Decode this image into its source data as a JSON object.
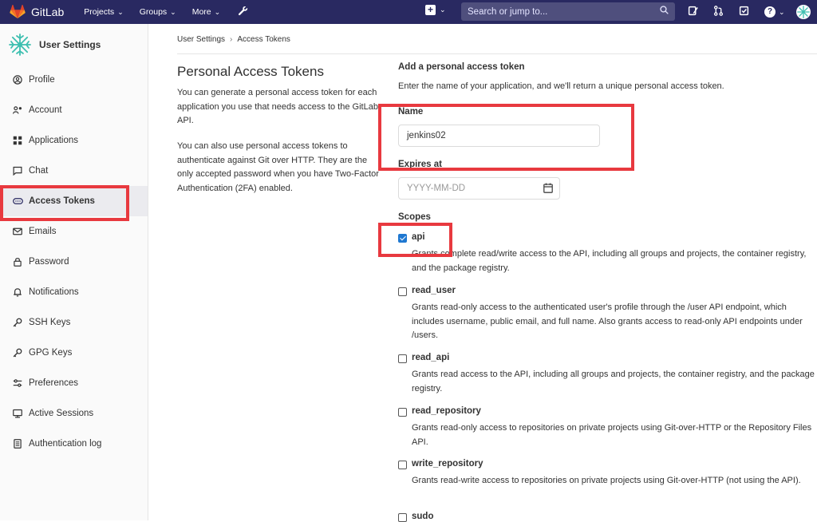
{
  "topbar": {
    "brand": "GitLab",
    "nav": [
      {
        "label": "Projects"
      },
      {
        "label": "Groups"
      },
      {
        "label": "More"
      }
    ],
    "search_placeholder": "Search or jump to..."
  },
  "sidebar": {
    "title": "User Settings",
    "items": [
      {
        "label": "Profile",
        "icon": "profile-icon",
        "active": false
      },
      {
        "label": "Account",
        "icon": "account-icon",
        "active": false
      },
      {
        "label": "Applications",
        "icon": "applications-icon",
        "active": false
      },
      {
        "label": "Chat",
        "icon": "chat-icon",
        "active": false
      },
      {
        "label": "Access Tokens",
        "icon": "token-icon",
        "active": true
      },
      {
        "label": "Emails",
        "icon": "mail-icon",
        "active": false
      },
      {
        "label": "Password",
        "icon": "lock-icon",
        "active": false
      },
      {
        "label": "Notifications",
        "icon": "bell-icon",
        "active": false
      },
      {
        "label": "SSH Keys",
        "icon": "key-icon",
        "active": false
      },
      {
        "label": "GPG Keys",
        "icon": "key-icon",
        "active": false
      },
      {
        "label": "Preferences",
        "icon": "preferences-icon",
        "active": false
      },
      {
        "label": "Active Sessions",
        "icon": "monitor-icon",
        "active": false
      },
      {
        "label": "Authentication log",
        "icon": "log-icon",
        "active": false
      }
    ]
  },
  "breadcrumb": {
    "parent": "User Settings",
    "current": "Access Tokens"
  },
  "intro": {
    "title": "Personal Access Tokens",
    "p1": "You can generate a personal access token for each application you use that needs access to the GitLab API.",
    "p2": "You can also use personal access tokens to authenticate against Git over HTTP. They are the only accepted password when you have Two-Factor Authentication (2FA) enabled."
  },
  "form": {
    "title": "Add a personal access token",
    "description": "Enter the name of your application, and we'll return a unique personal access token.",
    "name_label": "Name",
    "name_value": "jenkins02",
    "expires_label": "Expires at",
    "expires_placeholder": "YYYY-MM-DD",
    "scopes_label": "Scopes",
    "scopes": [
      {
        "name": "api",
        "checked": true,
        "description": "Grants complete read/write access to the API, including all groups and projects, the container registry, and the package registry."
      },
      {
        "name": "read_user",
        "checked": false,
        "description": "Grants read-only access to the authenticated user's profile through the /user API endpoint, which includes username, public email, and full name. Also grants access to read-only API endpoints under /users."
      },
      {
        "name": "read_api",
        "checked": false,
        "description": "Grants read access to the API, including all groups and projects, the container registry, and the package registry."
      },
      {
        "name": "read_repository",
        "checked": false,
        "description": "Grants read-only access to repositories on private projects using Git-over-HTTP or the Repository Files API."
      },
      {
        "name": "write_repository",
        "checked": false,
        "description": "Grants read-write access to repositories on private projects using Git-over-HTTP (not using the API)."
      },
      {
        "name": "sudo",
        "checked": false,
        "description": ""
      }
    ]
  },
  "colors": {
    "topbar": "#292961",
    "highlight": "#e8393f",
    "checkbox": "#1f78d1"
  }
}
